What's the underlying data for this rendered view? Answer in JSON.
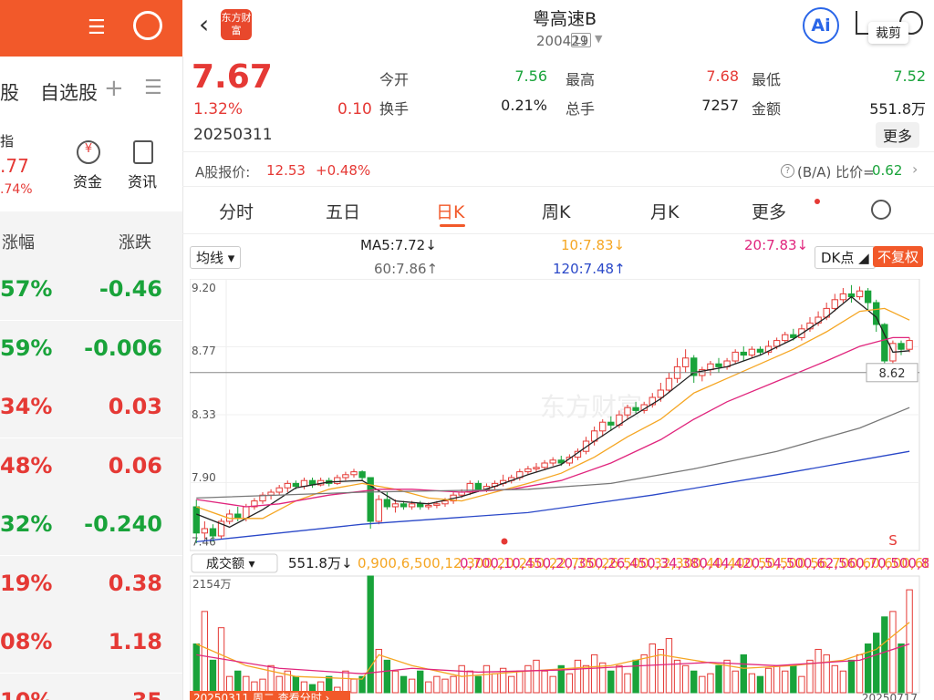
{
  "left": {
    "tabs": [
      "股",
      "自选股"
    ],
    "index_label": "指",
    "index_value": ".77",
    "index_change": ".74%",
    "shortcuts": [
      "资金",
      "资讯"
    ],
    "headers": [
      "涨幅",
      "涨跌"
    ],
    "rows": [
      {
        "pct": "57%",
        "chg": "-0.46",
        "color": "green"
      },
      {
        "pct": "59%",
        "chg": "-0.006",
        "color": "green"
      },
      {
        "pct": "34%",
        "chg": "0.03",
        "color": "red"
      },
      {
        "pct": "48%",
        "chg": "0.06",
        "color": "red"
      },
      {
        "pct": "32%",
        "chg": "-0.240",
        "color": "green"
      },
      {
        "pct": "19%",
        "chg": "0.38",
        "color": "red"
      },
      {
        "pct": "08%",
        "chg": "1.18",
        "color": "red"
      },
      {
        "pct": "10%",
        "chg": "35",
        "color": "red"
      }
    ]
  },
  "header": {
    "logo": "东方财富",
    "title": "粤高速B",
    "code": "200429",
    "level": "L1",
    "ai": "Ai",
    "crop": "裁剪"
  },
  "quote": {
    "price": "7.67",
    "pct": "1.32%",
    "chg": "0.10",
    "date": "20250311",
    "fields": [
      {
        "label": "今开",
        "value": "7.56",
        "color": "green"
      },
      {
        "label": "最高",
        "value": "7.68",
        "color": "red"
      },
      {
        "label": "最低",
        "value": "7.52",
        "color": "green"
      },
      {
        "label": "换手",
        "value": "0.21%",
        "color": "dark"
      },
      {
        "label": "总手",
        "value": "7257",
        "color": "dark"
      },
      {
        "label": "金额",
        "value": "551.8万",
        "color": "dark"
      }
    ],
    "more": "更多",
    "a_label": "A股报价:",
    "a_price": "12.53",
    "a_pct": "+0.48%",
    "ratio_label": "(B/A) 比价=",
    "ratio_value": "0.62"
  },
  "tabs": [
    "分时",
    "五日",
    "日K",
    "周K",
    "月K",
    "更多"
  ],
  "active_tab": "日K",
  "ma": {
    "dropdown": "均线",
    "ma5": "MA5:7.72↓",
    "ma10": "10:7.83↓",
    "ma20": "20:7.83↓",
    "ma60": "60:7.86↑",
    "ma120": "120:7.48↑",
    "dk": "DK点",
    "fq": "不复权"
  },
  "chart_data": {
    "type": "candlestick",
    "y_ticks": [
      "9.20",
      "8.77",
      "8.33",
      "7.90",
      "7.46"
    ],
    "cursor_price": "8.62",
    "watermark": "东方财富",
    "marker": "S",
    "candles": [
      [
        7.7,
        7.52,
        7.75,
        7.45
      ],
      [
        7.52,
        7.55,
        7.6,
        7.48
      ],
      [
        7.55,
        7.5,
        7.58,
        7.46
      ],
      [
        7.5,
        7.6,
        7.62,
        7.48
      ],
      [
        7.6,
        7.65,
        7.68,
        7.58
      ],
      [
        7.65,
        7.62,
        7.7,
        7.6
      ],
      [
        7.62,
        7.7,
        7.72,
        7.6
      ],
      [
        7.7,
        7.74,
        7.76,
        7.68
      ],
      [
        7.74,
        7.78,
        7.8,
        7.72
      ],
      [
        7.78,
        7.8,
        7.82,
        7.75
      ],
      [
        7.8,
        7.83,
        7.85,
        7.78
      ],
      [
        7.83,
        7.86,
        7.88,
        7.8
      ],
      [
        7.86,
        7.84,
        7.88,
        7.82
      ],
      [
        7.84,
        7.88,
        7.9,
        7.82
      ],
      [
        7.88,
        7.85,
        7.9,
        7.83
      ],
      [
        7.85,
        7.88,
        7.9,
        7.84
      ],
      [
        7.88,
        7.86,
        7.9,
        7.84
      ],
      [
        7.86,
        7.9,
        7.92,
        7.85
      ],
      [
        7.9,
        7.92,
        7.94,
        7.88
      ],
      [
        7.92,
        7.94,
        7.96,
        7.9
      ],
      [
        7.94,
        7.9,
        7.95,
        7.88
      ],
      [
        7.9,
        7.6,
        7.9,
        7.55
      ],
      [
        7.6,
        7.75,
        7.78,
        7.58
      ],
      [
        7.75,
        7.7,
        7.8,
        7.68
      ],
      [
        7.7,
        7.72,
        7.75,
        7.66
      ],
      [
        7.72,
        7.7,
        7.74,
        7.68
      ],
      [
        7.7,
        7.72,
        7.74,
        7.68
      ],
      [
        7.72,
        7.7,
        7.74,
        7.68
      ],
      [
        7.7,
        7.71,
        7.73,
        7.68
      ],
      [
        7.71,
        7.72,
        7.74,
        7.69
      ],
      [
        7.72,
        7.74,
        7.76,
        7.7
      ],
      [
        7.74,
        7.78,
        7.8,
        7.72
      ],
      [
        7.78,
        7.8,
        7.82,
        7.76
      ],
      [
        7.8,
        7.86,
        7.88,
        7.78
      ],
      [
        7.86,
        7.82,
        7.88,
        7.8
      ],
      [
        7.82,
        7.84,
        7.86,
        7.8
      ],
      [
        7.84,
        7.86,
        7.88,
        7.82
      ],
      [
        7.86,
        7.88,
        7.92,
        7.84
      ],
      [
        7.88,
        7.9,
        7.92,
        7.86
      ],
      [
        7.9,
        7.94,
        7.96,
        7.88
      ],
      [
        7.94,
        7.96,
        7.98,
        7.92
      ],
      [
        7.96,
        7.97,
        8.0,
        7.94
      ],
      [
        7.97,
        8.0,
        8.02,
        7.95
      ],
      [
        8.0,
        8.02,
        8.04,
        7.98
      ],
      [
        8.02,
        8.0,
        8.05,
        7.98
      ],
      [
        8.0,
        8.04,
        8.06,
        7.98
      ],
      [
        8.04,
        8.08,
        8.1,
        8.02
      ],
      [
        8.08,
        8.15,
        8.18,
        8.06
      ],
      [
        8.15,
        8.22,
        8.25,
        8.12
      ],
      [
        8.22,
        8.28,
        8.3,
        8.18
      ],
      [
        8.28,
        8.26,
        8.32,
        8.22
      ],
      [
        8.26,
        8.33,
        8.36,
        8.24
      ],
      [
        8.33,
        8.38,
        8.4,
        8.3
      ],
      [
        8.38,
        8.36,
        8.42,
        8.34
      ],
      [
        8.36,
        8.4,
        8.42,
        8.34
      ],
      [
        8.4,
        8.45,
        8.48,
        8.38
      ],
      [
        8.45,
        8.5,
        8.55,
        8.42
      ],
      [
        8.5,
        8.58,
        8.62,
        8.48
      ],
      [
        8.58,
        8.66,
        8.72,
        8.55
      ],
      [
        8.66,
        8.72,
        8.78,
        8.62
      ],
      [
        8.72,
        8.6,
        8.74,
        8.55
      ],
      [
        8.6,
        8.64,
        8.66,
        8.56
      ],
      [
        8.64,
        8.68,
        8.7,
        8.6
      ],
      [
        8.68,
        8.66,
        8.72,
        8.62
      ],
      [
        8.66,
        8.7,
        8.72,
        8.64
      ],
      [
        8.7,
        8.76,
        8.78,
        8.68
      ],
      [
        8.76,
        8.74,
        8.8,
        8.7
      ],
      [
        8.74,
        8.78,
        8.8,
        8.72
      ],
      [
        8.78,
        8.76,
        8.8,
        8.74
      ],
      [
        8.76,
        8.8,
        8.84,
        8.74
      ],
      [
        8.8,
        8.84,
        8.86,
        8.78
      ],
      [
        8.84,
        8.88,
        8.9,
        8.82
      ],
      [
        8.88,
        8.86,
        8.92,
        8.84
      ],
      [
        8.86,
        8.92,
        8.95,
        8.84
      ],
      [
        8.92,
        8.96,
        9.0,
        8.9
      ],
      [
        8.96,
        9.0,
        9.04,
        8.94
      ],
      [
        9.0,
        9.06,
        9.1,
        8.98
      ],
      [
        9.06,
        9.12,
        9.16,
        9.04
      ],
      [
        9.12,
        9.16,
        9.2,
        9.1
      ],
      [
        9.16,
        9.14,
        9.22,
        9.1
      ],
      [
        9.14,
        9.18,
        9.21,
        9.12
      ],
      [
        9.18,
        9.1,
        9.2,
        9.05
      ],
      [
        9.1,
        8.95,
        9.12,
        8.9
      ],
      [
        8.95,
        8.7,
        8.96,
        8.6
      ],
      [
        8.7,
        8.82,
        8.84,
        8.68
      ],
      [
        8.82,
        8.78,
        8.84,
        8.74
      ],
      [
        8.78,
        8.84,
        8.86,
        8.76
      ]
    ],
    "ma_lines": [
      {
        "name": "MA5",
        "color": "#222222",
        "values": [
          [
            0,
            7.65
          ],
          [
            4,
            7.56
          ],
          [
            8,
            7.68
          ],
          [
            12,
            7.83
          ],
          [
            16,
            7.87
          ],
          [
            20,
            7.88
          ],
          [
            24,
            7.74
          ],
          [
            28,
            7.72
          ],
          [
            32,
            7.77
          ],
          [
            36,
            7.84
          ],
          [
            40,
            7.92
          ],
          [
            44,
            7.99
          ],
          [
            48,
            8.15
          ],
          [
            52,
            8.3
          ],
          [
            56,
            8.44
          ],
          [
            60,
            8.62
          ],
          [
            64,
            8.66
          ],
          [
            68,
            8.74
          ],
          [
            72,
            8.85
          ],
          [
            76,
            9.0
          ],
          [
            79,
            9.14
          ],
          [
            82,
            9.0
          ],
          [
            84,
            8.76
          ],
          [
            86,
            8.77
          ]
        ]
      },
      {
        "name": "MA10",
        "color": "#f5a623",
        "values": [
          [
            0,
            7.7
          ],
          [
            4,
            7.62
          ],
          [
            8,
            7.62
          ],
          [
            12,
            7.74
          ],
          [
            16,
            7.82
          ],
          [
            20,
            7.86
          ],
          [
            24,
            7.82
          ],
          [
            28,
            7.76
          ],
          [
            32,
            7.74
          ],
          [
            36,
            7.8
          ],
          [
            40,
            7.86
          ],
          [
            44,
            7.93
          ],
          [
            48,
            8.04
          ],
          [
            52,
            8.18
          ],
          [
            56,
            8.3
          ],
          [
            60,
            8.48
          ],
          [
            64,
            8.58
          ],
          [
            68,
            8.68
          ],
          [
            72,
            8.78
          ],
          [
            76,
            8.9
          ],
          [
            80,
            9.04
          ],
          [
            83,
            9.06
          ],
          [
            86,
            8.98
          ]
        ]
      },
      {
        "name": "MA20",
        "color": "#e0257d",
        "values": [
          [
            0,
            7.75
          ],
          [
            6,
            7.7
          ],
          [
            10,
            7.72
          ],
          [
            16,
            7.78
          ],
          [
            22,
            7.82
          ],
          [
            26,
            7.82
          ],
          [
            32,
            7.8
          ],
          [
            38,
            7.82
          ],
          [
            44,
            7.88
          ],
          [
            50,
            8.0
          ],
          [
            56,
            8.16
          ],
          [
            60,
            8.3
          ],
          [
            64,
            8.42
          ],
          [
            70,
            8.56
          ],
          [
            76,
            8.7
          ],
          [
            80,
            8.8
          ],
          [
            84,
            8.86
          ],
          [
            86,
            8.86
          ]
        ]
      },
      {
        "name": "MA60",
        "color": "#777777",
        "values": [
          [
            0,
            7.76
          ],
          [
            20,
            7.8
          ],
          [
            40,
            7.82
          ],
          [
            50,
            7.86
          ],
          [
            60,
            7.96
          ],
          [
            70,
            8.08
          ],
          [
            80,
            8.24
          ],
          [
            86,
            8.38
          ]
        ]
      },
      {
        "name": "MA120",
        "color": "#2a48c8",
        "values": [
          [
            0,
            7.46
          ],
          [
            20,
            7.58
          ],
          [
            40,
            7.66
          ],
          [
            55,
            7.78
          ],
          [
            70,
            7.92
          ],
          [
            80,
            8.02
          ],
          [
            86,
            8.08
          ]
        ]
      }
    ],
    "volume": {
      "dropdown": "成交额",
      "last": "551.8万↓",
      "ma1": [
        [
          0,
          900
        ],
        [
          6,
          500
        ],
        [
          12,
          300
        ],
        [
          20,
          250
        ],
        [
          22,
          700
        ],
        [
          26,
          500
        ],
        [
          32,
          300
        ],
        [
          40,
          400
        ],
        [
          50,
          500
        ],
        [
          56,
          700
        ],
        [
          60,
          600
        ],
        [
          66,
          450
        ],
        [
          72,
          500
        ],
        [
          78,
          600
        ],
        [
          82,
          800
        ],
        [
          86,
          1300
        ]
      ],
      "ma2": [
        [
          0,
          700
        ],
        [
          10,
          450
        ],
        [
          20,
          350
        ],
        [
          26,
          450
        ],
        [
          34,
          380
        ],
        [
          44,
          420
        ],
        [
          54,
          500
        ],
        [
          62,
          560
        ],
        [
          70,
          500
        ],
        [
          80,
          600
        ],
        [
          86,
          900
        ]
      ],
      "max_label": "2154万",
      "start_date": "20250311 周二 查看分时",
      "end_date": "20250717",
      "bars": [
        900,
        1500,
        600,
        1200,
        300,
        400,
        300,
        200,
        250,
        500,
        300,
        400,
        300,
        200,
        150,
        200,
        300,
        100,
        400,
        250,
        300,
        2154,
        800,
        600,
        400,
        300,
        250,
        400,
        200,
        300,
        250,
        300,
        500,
        400,
        300,
        500,
        350,
        450,
        300,
        400,
        500,
        600,
        400,
        300,
        500,
        350,
        600,
        500,
        700,
        550,
        400,
        500,
        350,
        600,
        700,
        900,
        800,
        1000,
        600,
        500,
        400,
        300,
        350,
        500,
        600,
        400,
        700,
        350,
        300,
        450,
        500,
        400,
        500,
        300,
        600,
        800,
        700,
        500,
        400,
        600,
        700,
        900,
        1100,
        1400,
        1500,
        900,
        1900
      ]
    }
  }
}
